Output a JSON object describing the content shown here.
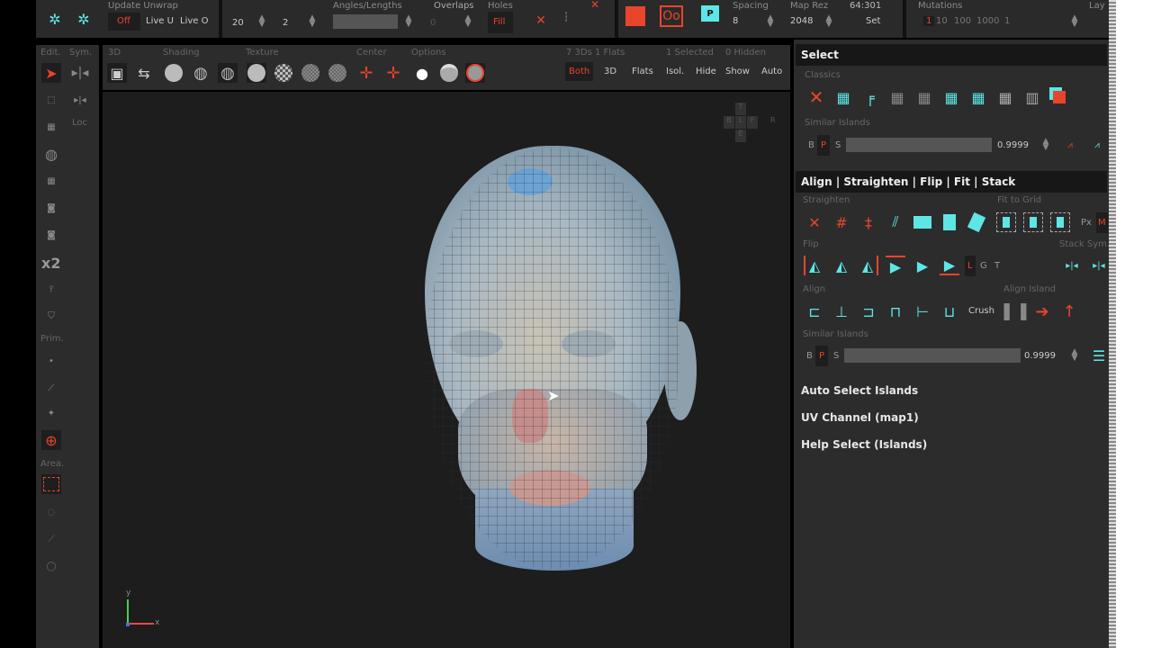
{
  "top": {
    "update_unwrap": {
      "label": "Update Unwrap",
      "off": "Off",
      "live_u": "Live U",
      "live_o": "Live O"
    },
    "unwrap": {
      "v1": "20",
      "v2": "2",
      "angles_label": "Angles/Lengths",
      "overlaps_label": "Overlaps",
      "overlaps_value": "0",
      "holes_label": "Holes",
      "fill": "Fill"
    },
    "pack": {
      "spacing_label": "Spacing",
      "spacing": "8",
      "maprez_label": "Map Rez",
      "maprez": "2048",
      "ratio": "64:301",
      "set": "Set"
    },
    "mutations": {
      "label": "Mutations",
      "values": [
        "1",
        "10",
        "100",
        "1000",
        "1"
      ]
    },
    "lay_label": "Lay"
  },
  "left_toolbar": {
    "edit": "Edit.",
    "sym": "Sym.",
    "loc": "Loc",
    "x2": "x2",
    "prim": "Prim.",
    "area": "Area."
  },
  "viewport_bar": {
    "sections": [
      "3D",
      "Shading",
      "Texture",
      "Center",
      "Options"
    ],
    "stats": "7 3Ds 1 Flats",
    "selected": "1 Selected",
    "hidden": "0 Hidden",
    "buttons": [
      "Both",
      "3D",
      "Flats",
      "Isol.",
      "Hide",
      "Show",
      "Auto"
    ],
    "cube_labels": [
      "T",
      "B",
      "L",
      "F",
      "R",
      "E"
    ],
    "axis_y": "y",
    "axis_x": "x"
  },
  "right_panel": {
    "select": {
      "title": "Select",
      "classics": "Classics",
      "similar": "Similar Islands",
      "b": "B",
      "p": "P",
      "s": "S",
      "value": "0.9999"
    },
    "align": {
      "title": "Align | Straighten | Flip | Fit | Stack",
      "straighten": "Straighten",
      "fit_to_grid": "Fit to Grid",
      "px": "Px",
      "m": "M",
      "flip": "Flip",
      "l": "L",
      "g": "G",
      "t": "T",
      "stack_sym": "Stack Sym.",
      "align": "Align",
      "crush": "Crush",
      "align_island": "Align Island",
      "similar": "Similar Islands",
      "b": "B",
      "p": "P",
      "s": "S",
      "value": "0.9999"
    },
    "collapsed": [
      "Auto Select Islands",
      "UV Channel (map1)",
      "Help Select (Islands)"
    ]
  },
  "colors": {
    "accent": "#e8452c",
    "cyan": "#5ee6e6",
    "bg": "#2c2c2c",
    "viewport": "#1e1e1e"
  }
}
